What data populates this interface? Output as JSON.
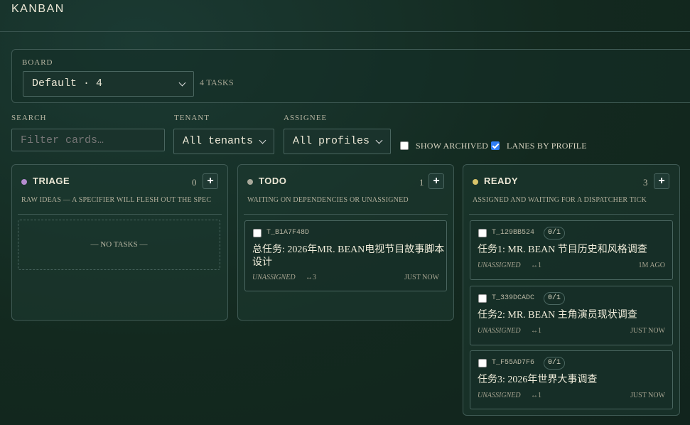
{
  "app": {
    "title": "KANBAN"
  },
  "board": {
    "label": "BOARD",
    "selected": "Default · 4",
    "task_count": "4 TASKS"
  },
  "filters": {
    "search": {
      "label": "SEARCH",
      "placeholder": "Filter cards…",
      "value": ""
    },
    "tenant": {
      "label": "TENANT",
      "selected": "All tenants"
    },
    "assignee": {
      "label": "ASSIGNEE",
      "selected": "All profiles"
    },
    "show_archived": {
      "label": "SHOW ARCHIVED",
      "checked": false
    },
    "lanes_by_profile": {
      "label": "LANES BY PROFILE",
      "checked": true
    }
  },
  "columns": [
    {
      "name": "TRIAGE",
      "count": "0",
      "dot_color": "#b48ccf",
      "description": "RAW IDEAS — A SPECIFIER WILL FLESH OUT THE SPEC",
      "empty_text": "— NO TASKS —",
      "add_label": "+"
    },
    {
      "name": "TODO",
      "count": "1",
      "dot_color": "#a8a89a",
      "description": "WAITING ON DEPENDENCIES OR UNASSIGNED",
      "add_label": "+",
      "cards": [
        {
          "id": "T_B1A7F48D",
          "title_line1": "总任务: 2026年MR. BEAN电视节目故事脚本",
          "title_line2": "设计",
          "assignee": "UNASSIGNED",
          "deps": "↔3",
          "time": "JUST NOW"
        }
      ]
    },
    {
      "name": "READY",
      "count": "3",
      "dot_color": "#d9c46a",
      "description": "ASSIGNED AND WAITING FOR A DISPATCHER TICK",
      "add_label": "+",
      "cards": [
        {
          "id": "T_129BB524",
          "progress": "0/1",
          "title": "任务1: MR. BEAN 节目历史和风格调查",
          "assignee": "UNASSIGNED",
          "deps": "↔1",
          "time": "1M AGO"
        },
        {
          "id": "T_339DCADC",
          "progress": "0/1",
          "title": "任务2: MR. BEAN 主角演员现状调查",
          "assignee": "UNASSIGNED",
          "deps": "↔1",
          "time": "JUST NOW"
        },
        {
          "id": "T_F55AD7F6",
          "progress": "0/1",
          "title": "任务3: 2026年世界大事调查",
          "assignee": "UNASSIGNED",
          "deps": "↔1",
          "time": "JUST NOW"
        }
      ]
    }
  ]
}
